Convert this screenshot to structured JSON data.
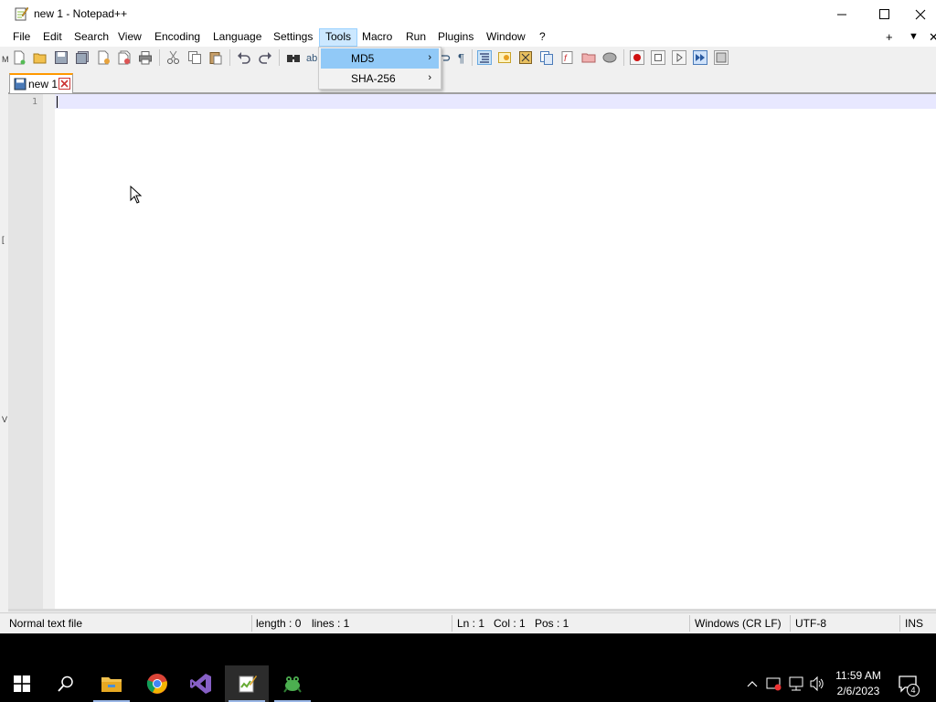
{
  "window": {
    "title": "new 1 - Notepad++"
  },
  "menu": {
    "items": [
      "File",
      "Edit",
      "Search",
      "View",
      "Encoding",
      "Language",
      "Settings",
      "Tools",
      "Macro",
      "Run",
      "Plugins",
      "Window",
      "?"
    ],
    "active": "Tools",
    "right_plus": "+",
    "right_down": "▼",
    "right_close": "✕"
  },
  "tools_menu": {
    "items": [
      {
        "label": "MD5",
        "highlighted": true
      },
      {
        "label": "SHA-256",
        "highlighted": false
      }
    ],
    "submenu_arrow": "›"
  },
  "tab": {
    "label": "new 1"
  },
  "editor": {
    "line_number": "1",
    "left_strip_chars": [
      "M",
      "[",
      "V"
    ]
  },
  "status": {
    "file_type": "Normal text file",
    "length": "length : 0",
    "lines": "lines : 1",
    "ln": "Ln : 1",
    "col": "Col : 1",
    "pos": "Pos : 1",
    "eol": "Windows (CR LF)",
    "encoding": "UTF-8",
    "mode": "INS"
  },
  "taskbar": {
    "time": "11:59 AM",
    "date": "2/6/2023",
    "notification_count": "4"
  },
  "colors": {
    "menu_active_bg": "#cce8ff",
    "dropdown_highlight": "#91c9f7",
    "current_line": "#e8e8ff",
    "tab_accent": "#ff9900"
  }
}
